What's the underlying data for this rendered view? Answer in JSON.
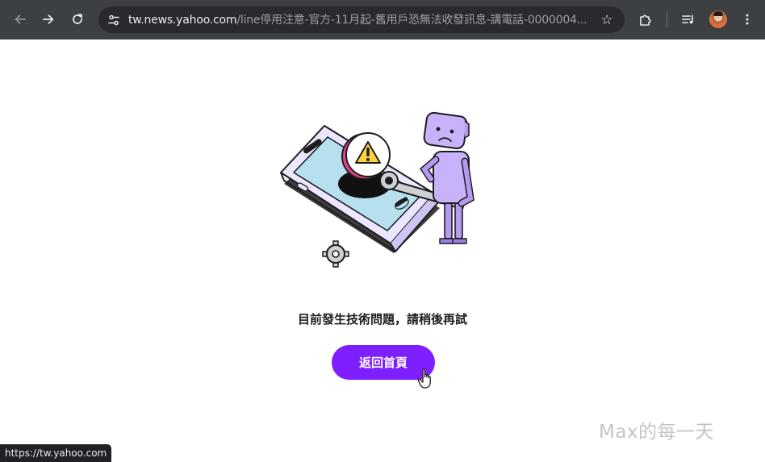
{
  "browser": {
    "url_host": "tw.news.yahoo.com",
    "url_path": "/line停用注意-官方-11月起-舊用戶恐無法收發訊息-講電話-0000004...",
    "icons": {
      "back": "arrow-left-icon",
      "forward": "arrow-right-icon",
      "reload": "reload-icon",
      "site_info": "tune-icon",
      "bookmark": "star-icon",
      "extensions": "puzzle-icon",
      "media": "media-queue-icon",
      "profile": "avatar",
      "menu": "kebab-menu-icon"
    },
    "theme": {
      "toolbar": "#3c4043",
      "omnibox": "#282a2d"
    }
  },
  "page": {
    "error_message": "目前發生技術問題，請稍後再試",
    "home_button_label": "返回首頁",
    "accent_color": "#7e1fff",
    "illustration": "broken-phone-robot-illustration"
  },
  "watermark": "Max的每一天",
  "status_bar": {
    "link_url": "https://tw.yahoo.com"
  }
}
